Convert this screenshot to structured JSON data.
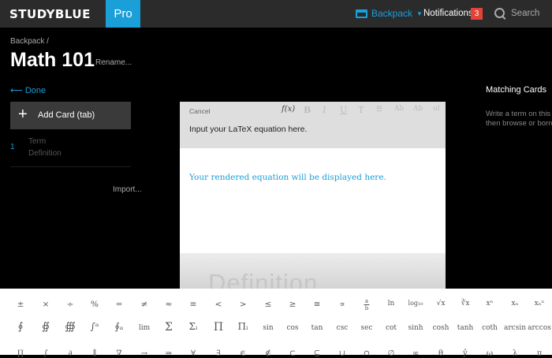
{
  "header": {
    "logo": "STUDYBLUE",
    "pro_label": "Pro",
    "backpack_label": "Backpack",
    "notifications_label": "Notifications",
    "notifications_count": "3",
    "search_placeholder": "Search",
    "accent_color": "#1a9fd9",
    "badge_color": "#e34236"
  },
  "page": {
    "breadcrumb": "Backpack /",
    "title": "Math 101",
    "rename_label": "Rename..."
  },
  "sidebar": {
    "done_label": "Done",
    "add_card_label": "Add Card (tab)",
    "card": {
      "number": "1",
      "term": "Term",
      "definition": "Definition"
    },
    "import_label": "Import..."
  },
  "matching": {
    "title": "Matching Cards",
    "desc_line1": "Write a term on this",
    "desc_line2": "then browse or borrow"
  },
  "editor": {
    "cancel_label": "Cancel",
    "toolbar": [
      "f(x)",
      "B",
      "I",
      "U",
      "T",
      "list",
      "Ab",
      "Ab",
      "ul"
    ],
    "input_placeholder": "Input your LaTeX equation here.",
    "rendered_placeholder": "Your rendered equation will be displayed here.",
    "definition_placeholder": "Definition"
  },
  "symbols": {
    "row1": [
      "±",
      "×",
      "÷",
      "%",
      "=",
      "≠",
      "≈",
      "≡",
      "<",
      ">",
      "≤",
      "≥",
      "≅",
      "∝",
      "a/b",
      "ln",
      "log₁₀",
      "√x",
      "∛x",
      "xⁿ",
      "xₙ",
      "xₙⁿ"
    ],
    "row2": [
      "∮",
      "∯",
      "∰",
      "∫ᵃ",
      "∮ₐ",
      "lim",
      "Σ",
      "Σᵢ",
      "Π",
      "Πᵢ",
      "sin",
      "cos",
      "tan",
      "csc",
      "sec",
      "cot",
      "sinh",
      "cosh",
      "tanh",
      "coth",
      "arcsin",
      "arccos"
    ],
    "row3": [
      "∏",
      "∫",
      "∂",
      "∥",
      "∇",
      "→",
      "⇒",
      "∀",
      "∃",
      "∈",
      "∉",
      "⊂",
      "⊆",
      "∪",
      "∩",
      "∅",
      "∞",
      "θ",
      "ŷ",
      "ω",
      "λ",
      "π"
    ]
  }
}
